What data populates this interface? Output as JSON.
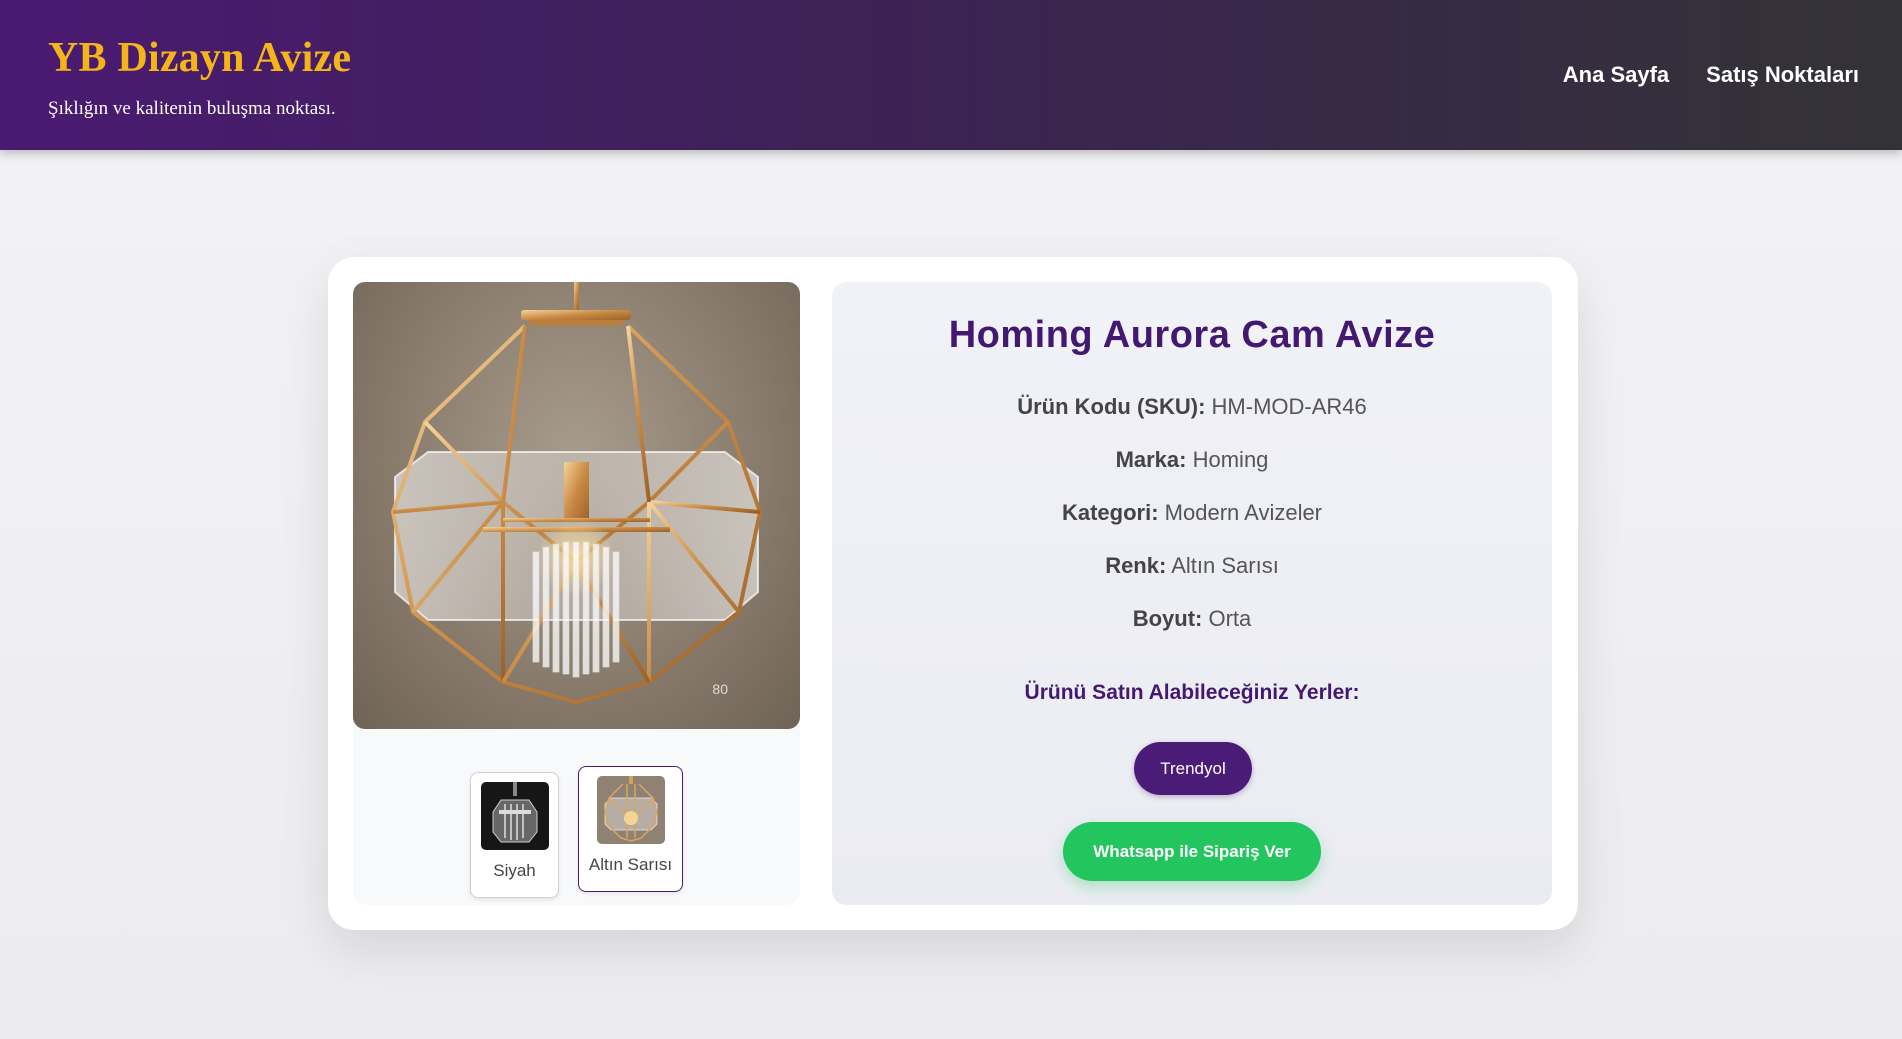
{
  "header": {
    "brand": "YB Dizayn Avize",
    "tagline": "Şıklığın ve kalitenin buluşma noktası.",
    "nav": [
      "Ana Sayfa",
      "Satış Noktaları"
    ]
  },
  "gallery": {
    "image_number": "80",
    "variants": [
      {
        "label": "Siyah",
        "active": false
      },
      {
        "label": "Altın Sarısı",
        "active": true
      }
    ]
  },
  "product": {
    "title": "Homing Aurora Cam Avize",
    "specs": [
      {
        "label": "Ürün Kodu (SKU):",
        "value": "HM-MOD-AR46"
      },
      {
        "label": "Marka:",
        "value": "Homing"
      },
      {
        "label": "Kategori:",
        "value": "Modern Avizeler"
      },
      {
        "label": "Renk:",
        "value": "Altın Sarısı"
      },
      {
        "label": "Boyut:",
        "value": "Orta"
      }
    ],
    "where_to_buy_title": "Ürünü Satın Alabileceğiniz Yerler:",
    "trendyol_label": "Trendyol",
    "whatsapp_label": "Whatsapp ile Sipariş Ver"
  },
  "colors": {
    "brand_purple": "#4a1b77",
    "brand_gold": "#f5b41a",
    "whatsapp_green": "#22c55e"
  }
}
